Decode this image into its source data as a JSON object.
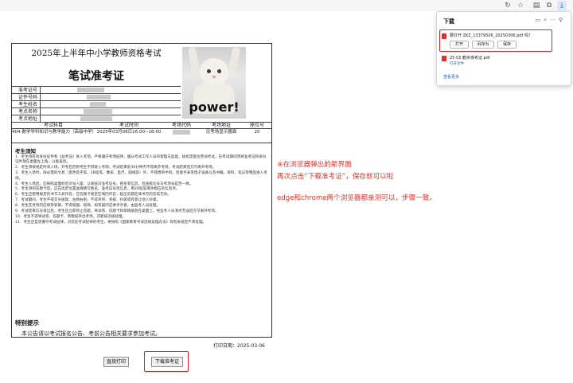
{
  "toolbar": {
    "icons": [
      "refresh-icon",
      "star-icon",
      "favorites-icon",
      "collections-icon",
      "download-icon",
      "pin-icon"
    ]
  },
  "ticket": {
    "title": "2025年上半年中小学教师资格考试",
    "subtitle": "笔试准考证",
    "photo_text": "power!",
    "fields": [
      "准考证号",
      "证件号码",
      "考生姓名",
      "考点名称",
      "考点地址"
    ],
    "grid_headers": [
      "考试科目",
      "考试时间",
      "考场代码",
      "考场地址",
      "座位号"
    ],
    "row": {
      "subject": "404-数学学科知识与教学能力（高级中学）",
      "time": "2025年03月08日16:00~18:00",
      "room_address": "见考场显示器面",
      "seat": "20"
    },
    "notes_heading": "考生须知",
    "notes": [
      "1．考生持有效身份证件和《准考证》进入考场，严格遵守考场纪律，服从考试工作人员的管理与监督，按指定座位参加考试，在考试期间须将准考证和身份证件放在桌面左上角，以备查验。",
      "2．考生须按规定时间入场，开考后迟到考生不得进入考场；考试结束前30分钟内不得离开考场，考试结束后方可离开考场。",
      "3．考生入场时，除必需的文具（黑色签字笔、2B铅笔、橡皮、直尺、圆规等）外，不得携带手机、智能手表等电子设备以及书籍、资料、笔记等物品进入考场。",
      "4．考生入场后，应按照桌面标签对号入座，认真核对准考证号、姓名等信息，检查座位号与考场号是否一致。",
      "5．考生领到答题卡后，应在指定位置准确填写姓名、准考证号等信息，用2B铅笔填涂相应的信息点。",
      "6．考生应使用规定的书写工具作答，在答题卡规定区域内作答，超出答题区域书写的答案无效。",
      "7．考试期间，考生不得交头接耳、左顾右盼，不得夹带、旁窥、抄袭或有意让他人抄袭。",
      "8．考生在考场内应保持安静，不得吸烟、喧哗，如有疑问应举手示意，由监考人员处理。",
      "9．考试结束信号发出后，考生应立即停止答题，将试卷、答题卡和草稿纸放在桌面上，经监考人员清点无误后方可离开考场。",
      "10．考生不得将试卷、答题卡、草稿纸带出考场，违者按违规处理。",
      "11．考生应自觉遵守考试纪律，对违反考试纪律的考生，将按照《国家教育考试违规处理办法》等有关规定严肃处理。"
    ],
    "special_heading": "特别提示",
    "special_text": "本公告请以考试报名公告、考前公告相关要求参加考试。",
    "print_date": "打印日期：2025-03-06"
  },
  "buttons": {
    "print": "直接打印",
    "download": "下载准考证"
  },
  "annotation": {
    "line1": "④在浏览器弹出的新界面",
    "line2": "再次点击“下载准考证”，保存就可以啦",
    "line3": "edge和chrome两个浏览器都亲测可以，步骤一致。"
  },
  "download_popup": {
    "title": "下载",
    "item1": {
      "name": "要打开 ZKZ_13379506_20250306.pdf 吗？",
      "open": "打开",
      "save_as": "另存为",
      "save": "保存"
    },
    "item2": {
      "name": "25.03 教资准考证.pdf",
      "link": "打开文件"
    },
    "more": "查看更多"
  },
  "colors": {
    "accent": "#e02020",
    "link": "#1a5fc8"
  }
}
